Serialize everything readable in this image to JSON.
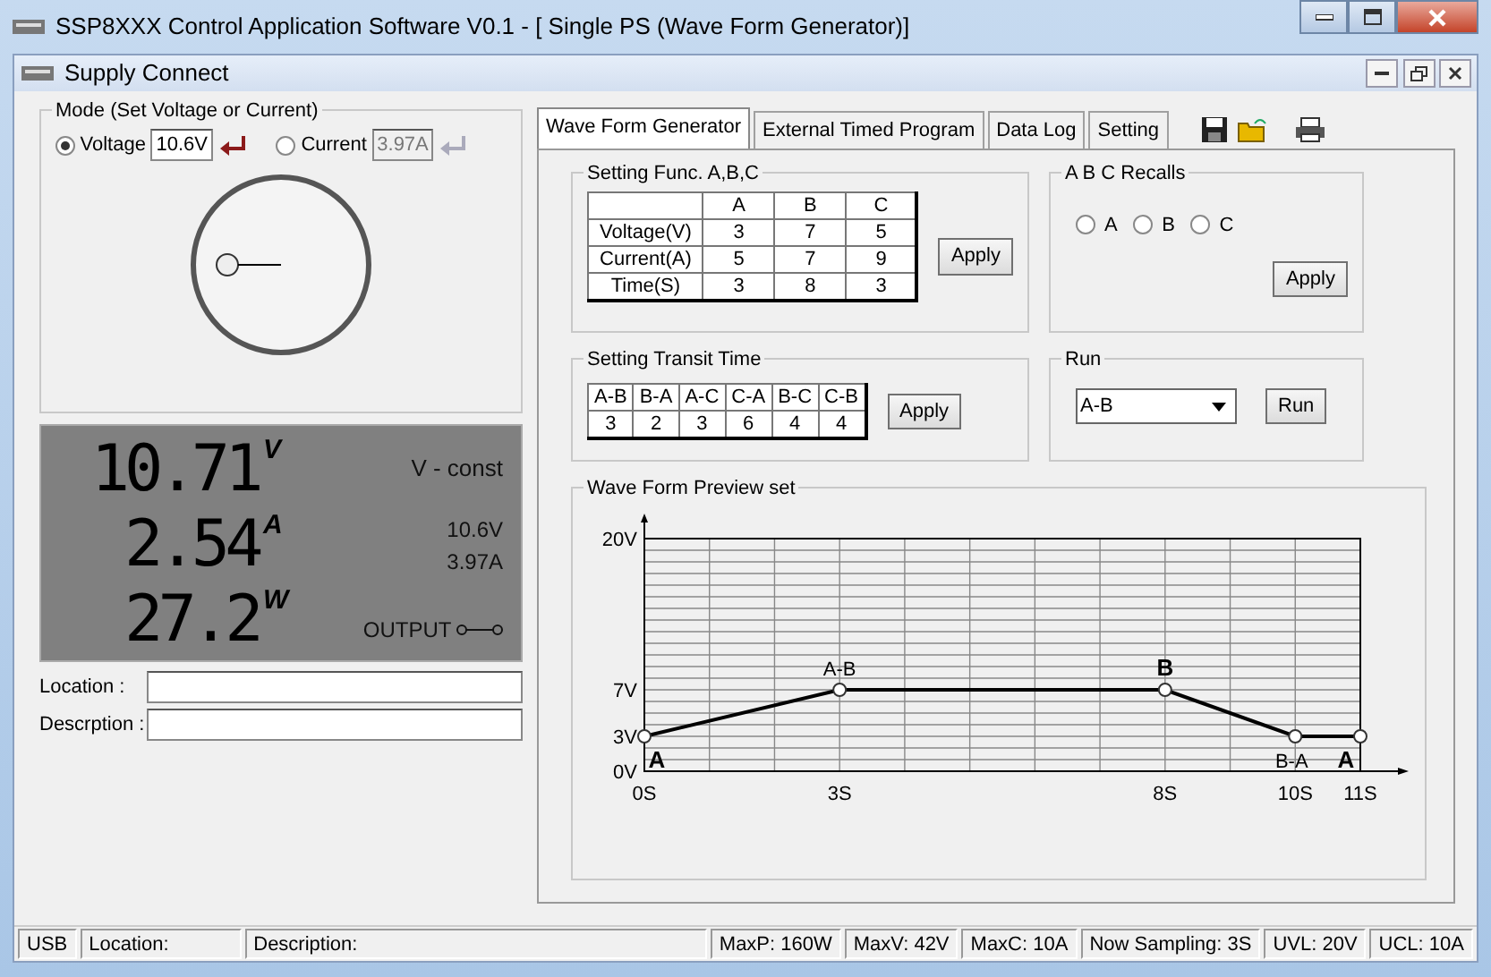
{
  "window": {
    "title": "SSP8XXX Control Application Software V0.1 - [ Single PS (Wave Form Generator)]"
  },
  "child_window": {
    "title": "Supply Connect"
  },
  "mode": {
    "title": "Mode (Set Voltage or Current)",
    "options": [
      {
        "label": "Voltage",
        "selected": true,
        "value": "10.6V",
        "disabled": false
      },
      {
        "label": "Current",
        "selected": false,
        "value": "3.97A",
        "disabled": true
      }
    ]
  },
  "lcd": {
    "readings": [
      {
        "value": "10.71",
        "unit": "V"
      },
      {
        "value": "2.54",
        "unit": "A"
      },
      {
        "value": "27.2",
        "unit": "W"
      }
    ],
    "mode": "V - const",
    "set_voltage": "10.6V",
    "set_current": "3.97A",
    "output_label": "OUTPUT",
    "output_on": false
  },
  "fields": [
    {
      "label": "Location :"
    },
    {
      "label": "Descrption :"
    }
  ],
  "tabs": [
    {
      "label": "Wave Form Generator",
      "selected": true
    },
    {
      "label": "External Timed Program",
      "selected": false
    },
    {
      "label": "Data Log",
      "selected": false
    },
    {
      "label": "Setting",
      "selected": false
    }
  ],
  "func_group": {
    "title": "Setting Func. A,B,C",
    "columns": [
      "A",
      "B",
      "C"
    ],
    "rows": [
      {
        "label": "Voltage(V)",
        "values": [
          "3",
          "7",
          "5"
        ]
      },
      {
        "label": "Current(A)",
        "values": [
          "5",
          "7",
          "9"
        ]
      },
      {
        "label": "Time(S)",
        "values": [
          "3",
          "8",
          "3"
        ]
      }
    ],
    "button": "Apply"
  },
  "recalls": {
    "title": "A B C Recalls",
    "options": [
      {
        "label": "A",
        "selected": false
      },
      {
        "label": "B",
        "selected": false
      },
      {
        "label": "C",
        "selected": false
      }
    ],
    "button": "Apply"
  },
  "transit": {
    "title": "Setting Transit Time",
    "columns": [
      "A-B",
      "B-A",
      "A-C",
      "C-A",
      "B-C",
      "C-B"
    ],
    "values": [
      "3",
      "2",
      "3",
      "6",
      "4",
      "4"
    ],
    "button": "Apply"
  },
  "run": {
    "title": "Run",
    "select": "A-B",
    "button": "Run"
  },
  "preview": {
    "title": "Wave Form Preview set",
    "chart_data": {
      "type": "line",
      "x": [
        0,
        3,
        8,
        10,
        11
      ],
      "series": [
        {
          "color": "#000000",
          "values": [
            3,
            7,
            7,
            3,
            3
          ],
          "marker": "circle"
        }
      ],
      "grid": true,
      "xlim": [
        0,
        11
      ],
      "ylim": [
        0,
        20
      ],
      "xticks": [
        {
          "value": 0,
          "label": "0S"
        },
        {
          "value": 3,
          "label": "3S"
        },
        {
          "value": 8,
          "label": "8S"
        },
        {
          "value": 10,
          "label": "10S"
        },
        {
          "value": 11,
          "label": "11S"
        }
      ],
      "yticks": [
        {
          "value": 0,
          "label": "0V"
        },
        {
          "value": 3,
          "label": "3V"
        },
        {
          "value": 7,
          "label": "7V"
        },
        {
          "value": 20,
          "label": "20V"
        }
      ],
      "annotations": [
        {
          "x": 0,
          "y": 3,
          "text": "A"
        },
        {
          "x": 3,
          "y": 7,
          "text": "A-B"
        },
        {
          "x": 8,
          "y": 7,
          "text": "B"
        },
        {
          "x": 10,
          "y": 3,
          "text": "B-A"
        },
        {
          "x": 11,
          "y": 3,
          "text": "A"
        }
      ]
    }
  },
  "status_bar": [
    "USB",
    "Location:",
    "Description:",
    "MaxP: 160W",
    "MaxV: 42V",
    "MaxC: 10A",
    "Now Sampling: 3S",
    "UVL: 20V",
    "UCL: 10A"
  ]
}
